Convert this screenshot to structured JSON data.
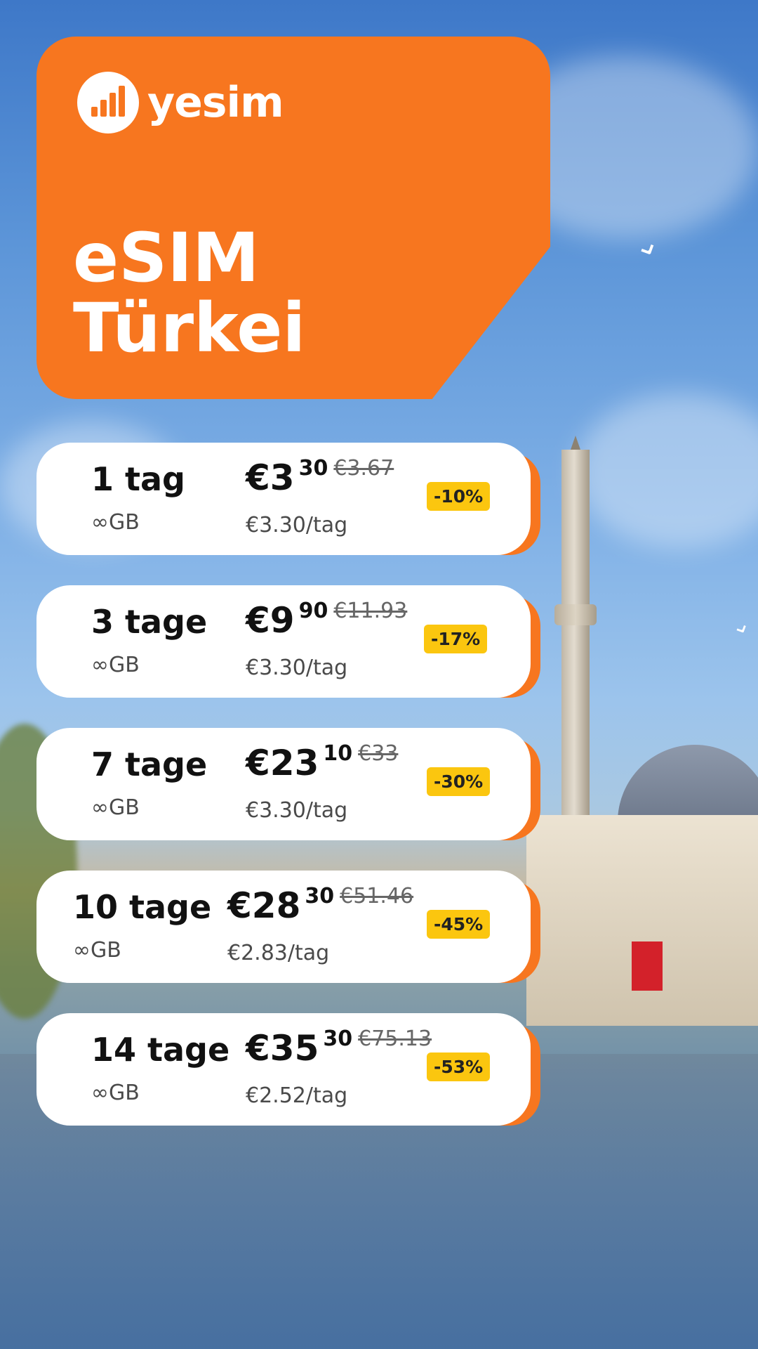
{
  "brand": {
    "name": "yesim"
  },
  "hero": {
    "line1": "eSIM",
    "line2": "Türkei"
  },
  "plans": [
    {
      "duration": "1 tag",
      "data": "∞GB",
      "price_main": "€3",
      "price_cents": "30",
      "price_old": "€3.67",
      "per_day": "€3.30/tag",
      "discount": "-10%"
    },
    {
      "duration": "3 tage",
      "data": "∞GB",
      "price_main": "€9",
      "price_cents": "90",
      "price_old": "€11.93",
      "per_day": "€3.30/tag",
      "discount": "-17%"
    },
    {
      "duration": "7 tage",
      "data": "∞GB",
      "price_main": "€23",
      "price_cents": "10",
      "price_old": "€33",
      "per_day": "€3.30/tag",
      "discount": "-30%"
    },
    {
      "duration": "10 tage",
      "data": "∞GB",
      "price_main": "€28",
      "price_cents": "30",
      "price_old": "€51.46",
      "per_day": "€2.83/tag",
      "discount": "-45%"
    },
    {
      "duration": "14 tage",
      "data": "∞GB",
      "price_main": "€35",
      "price_cents": "30",
      "price_old": "€75.13",
      "per_day": "€2.52/tag",
      "discount": "-53%"
    }
  ],
  "colors": {
    "brand_orange": "#f7761f",
    "badge_yellow": "#fbc60f"
  },
  "icons": {
    "logo": "signal-bars-icon",
    "bird": "seagull-icon"
  }
}
